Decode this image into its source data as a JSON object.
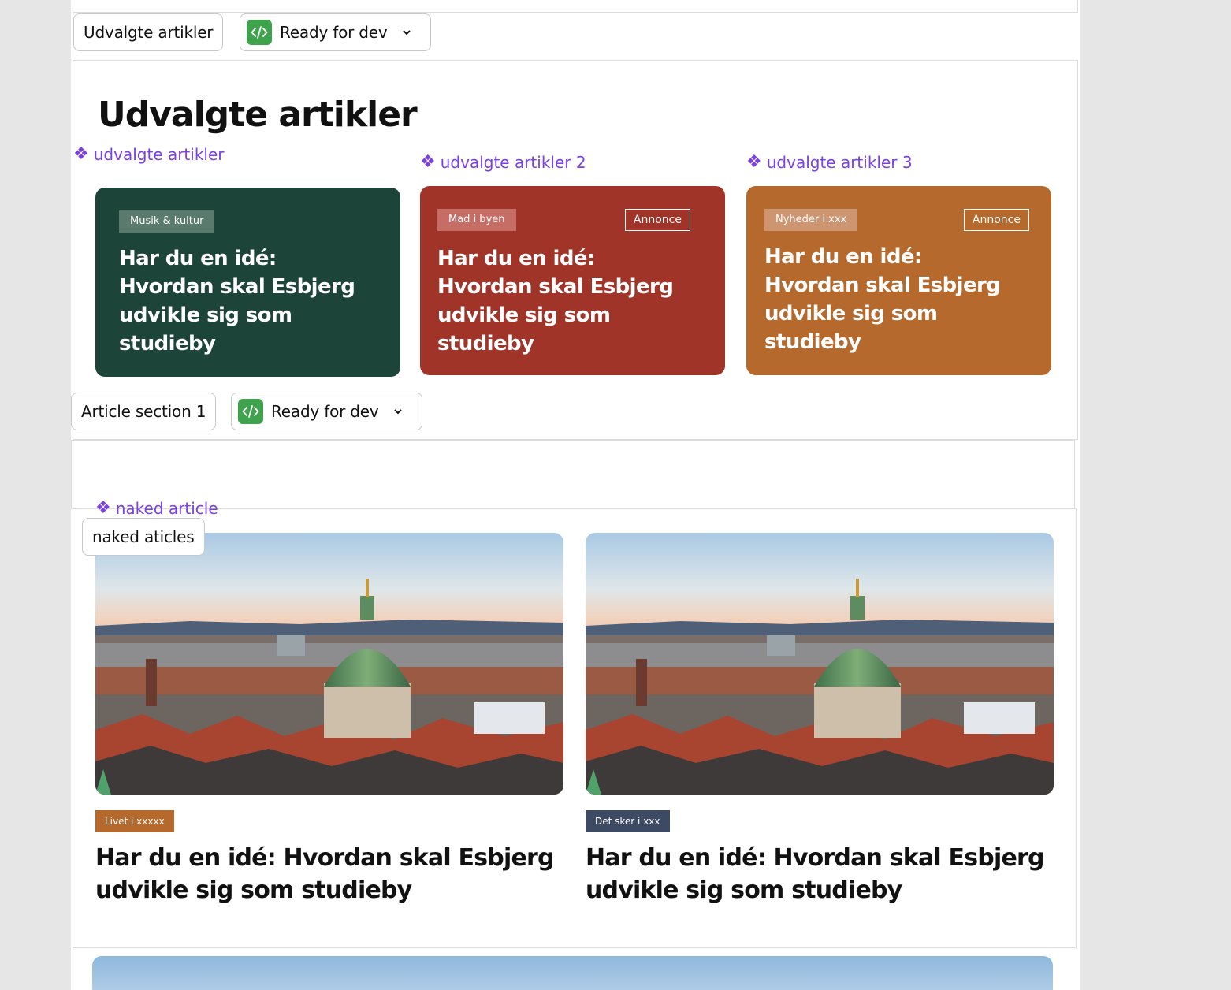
{
  "colors": {
    "card_green": "#1c4439",
    "card_red": "#a13428",
    "card_orange": "#b5692c",
    "component_purple": "#7b3fe4",
    "status_green": "#3fa34d",
    "tag_orange": "#b5692c",
    "tag_slate": "#3d4a63"
  },
  "top_frame": {
    "name_label": "Udvalgte artikler",
    "status": {
      "icon": "code-icon",
      "label": "Ready for dev",
      "chevron": "chevron-down-icon"
    }
  },
  "featured": {
    "title": "Udvalgte artikler",
    "components": [
      {
        "label": "udvalgte artikler",
        "tag": "Musik & kultur",
        "ad": "",
        "title": "Har du en idé: Hvordan skal Esbjerg udvikle sig som studieby"
      },
      {
        "label": "udvalgte artikler 2",
        "tag": "Mad i byen",
        "ad": "Annonce",
        "title": "Har du en idé: Hvordan skal Esbjerg udvikle sig som studieby"
      },
      {
        "label": "udvalgte artikler 3",
        "tag": "Nyheder i xxx",
        "ad": "Annonce",
        "title": "Har du en idé: Hvordan skal Esbjerg udvikle sig som studieby"
      }
    ]
  },
  "section_frame": {
    "name_label": "Article section 1",
    "status": {
      "icon": "code-icon",
      "label": "Ready for dev",
      "chevron": "chevron-down-icon"
    }
  },
  "naked": {
    "component_label": "naked article",
    "frame_label": "naked aticles",
    "articles": [
      {
        "tag": "Livet i xxxxx",
        "title": "Har du en idé: Hvordan skal Esbjerg udvikle sig som studieby"
      },
      {
        "tag": "Det sker i xxx",
        "title": "Har du en idé: Hvordan skal Esbjerg udvikle sig som studieby"
      }
    ]
  }
}
